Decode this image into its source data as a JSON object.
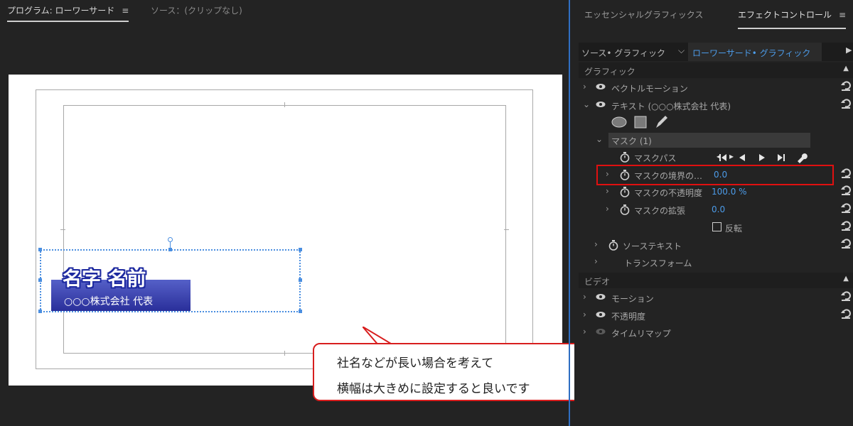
{
  "program_monitor": {
    "tab_label": "プログラム: ローワーサード",
    "source_tab_label": "ソース：(クリップなし)",
    "menu_icon": "hamburger-icon",
    "lower_third": {
      "name_text": "名字 名前",
      "company_text": "○○○株式会社 代表",
      "bar_color": "#2a2f9a"
    }
  },
  "callout": {
    "line1": "社名などが長い場合を考えて",
    "line2": "横幅は大きめに設定すると良いです",
    "border_color": "#d81e1e"
  },
  "effect_panel": {
    "tab_essential": "エッセンシャルグラフィックス",
    "tab_effect_controls": "エフェクトコントロール",
    "source_label": "ソース• グラフィック",
    "clip_label": "ローワーサード• グラフィック",
    "sections": {
      "graphics": "グラフィック",
      "video": "ビデオ"
    },
    "rows": {
      "vector_motion": "ベクトルモーション",
      "text_layer": "テキスト (○○○株式会社 代表)",
      "mask": "マスク (1)",
      "mask_path": "マスクパス",
      "mask_feather": {
        "label": "マスクの境界の…",
        "value": "0.0"
      },
      "mask_opacity": {
        "label": "マスクの不透明度",
        "value": "100.0 %"
      },
      "mask_expansion": {
        "label": "マスクの拡張",
        "value": "0.0"
      },
      "invert": "反転",
      "source_text": "ソーステキスト",
      "transform": "トランスフォーム",
      "motion": "モーション",
      "opacity": "不透明度",
      "time_remap": "タイムリマップ"
    },
    "accent_color": "#4c9be8",
    "highlight_color": "#e01010"
  }
}
